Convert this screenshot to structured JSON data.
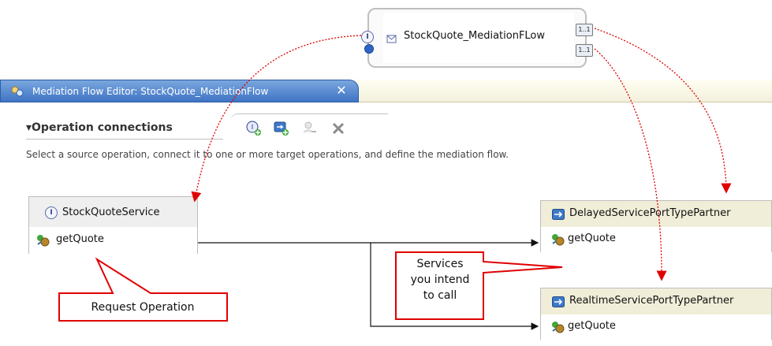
{
  "component": {
    "name": "StockQuote_MediationFLow",
    "input_icon": "interface-icon",
    "reference_labels": [
      "1..1",
      "1..1"
    ]
  },
  "editor_tab": {
    "title": "Mediation Flow Editor: StockQuote_MediationFlow",
    "close_label": "✕"
  },
  "section": {
    "title": "Operation connections",
    "description": "Select a source operation, connect it to one or more target operations, and define the mediation flow.",
    "toolbar_icons": [
      "add-interface-icon",
      "add-reference-icon",
      "remove-reference-icon",
      "delete-icon"
    ]
  },
  "source": {
    "interface_label": "StockQuoteService",
    "operation": "getQuote"
  },
  "targets": [
    {
      "partner": "DelayedServicePortTypePartner",
      "operation": "getQuote"
    },
    {
      "partner": "RealtimeServicePortTypePartner",
      "operation": "getQuote"
    }
  ],
  "callouts": {
    "request_operation": "Request Operation",
    "services_line1": "Services",
    "services_line2": "you intend",
    "services_line3": "to call"
  },
  "colors": {
    "tab_blue": "#4f84d0",
    "callout_red": "#e00000",
    "arrow_red": "#e00000"
  }
}
